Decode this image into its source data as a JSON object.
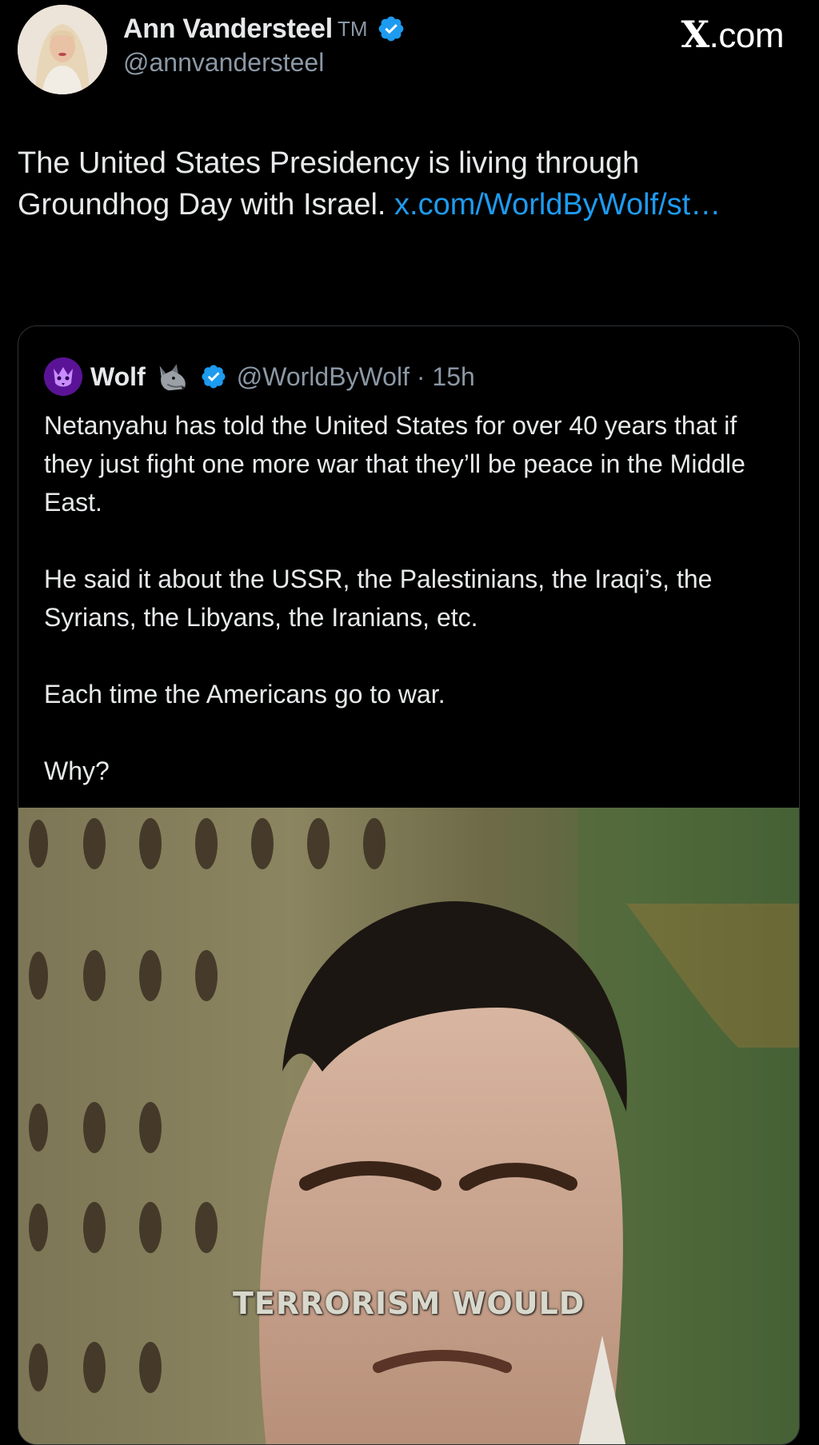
{
  "post": {
    "author_name": "Ann Vandersteel",
    "author_tm": "TM",
    "author_handle": "@annvandersteel",
    "site_label": "X.com",
    "site_label_x": "X",
    "site_label_rest": ".com",
    "text": "The United States Presidency is living through Groundhog Day with Israel. ",
    "link_text": "x.com/WorldByWolf/st…"
  },
  "quote": {
    "author_name": "Wolf",
    "author_handle": "@WorldByWolf",
    "separator": " · ",
    "time": "15h",
    "paragraphs": [
      "Netanyahu has told the United States for over 40 years that if they just fight one more war that they’ll be peace in the Middle East.",
      "He said it about the USSR, the Palestinians, the Iraqi’s, the Syrians, the Libyans, the Iranians, etc.",
      "Each time the Americans go to war.",
      "Why?"
    ],
    "media_caption": "TERRORISM WOULD"
  },
  "colors": {
    "background": "#000000",
    "text_primary": "#e7e9ea",
    "text_secondary": "#8b98a5",
    "link": "#1d9bf0",
    "verified": "#1d9bf0",
    "border": "#2f3336"
  },
  "icons": {
    "verified": "verified-badge-icon",
    "wolf": "wolf-emoji-icon"
  }
}
